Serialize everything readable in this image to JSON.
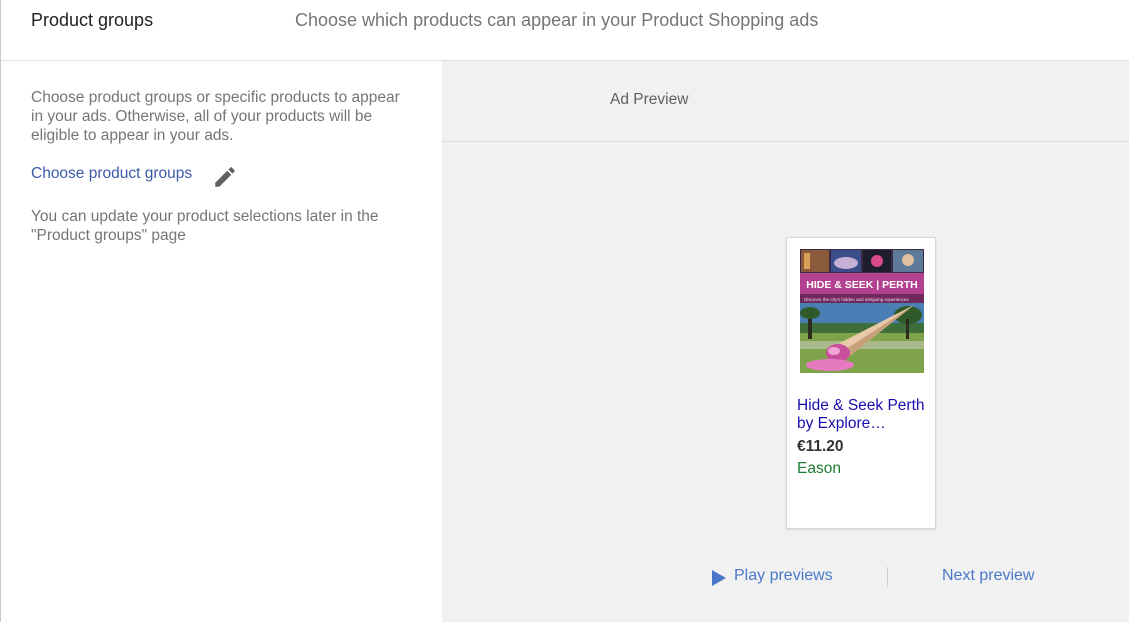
{
  "header": {
    "title": "Product groups",
    "description": "Choose which products can appear in your Product Shopping ads"
  },
  "left_panel": {
    "intro": "Choose product groups or specific products to appear in your ads. Otherwise, all of your products will be eligible to appear in your ads.",
    "choose_link": "Choose product groups",
    "edit_icon": "pencil-icon",
    "update_note": "You can update your product selections later in the \"Product groups\" page"
  },
  "preview": {
    "title": "Ad Preview",
    "card": {
      "image_title": "HIDE & SEEK | PERTH",
      "image_subtitle": "Discover the city's hidden and intriguing experiences",
      "product_title": "Hide & Seek Perth by Explore…",
      "price": "€11.20",
      "merchant": "Eason"
    },
    "play_label": "Play previews",
    "play_icon": "play-icon",
    "next_label": "Next preview"
  },
  "colors": {
    "link": "#3b5aa8",
    "action": "#4a78c9",
    "product_title": "#1a0dab",
    "merchant": "#1e7e34",
    "preview_bg": "#f1f1f1"
  }
}
